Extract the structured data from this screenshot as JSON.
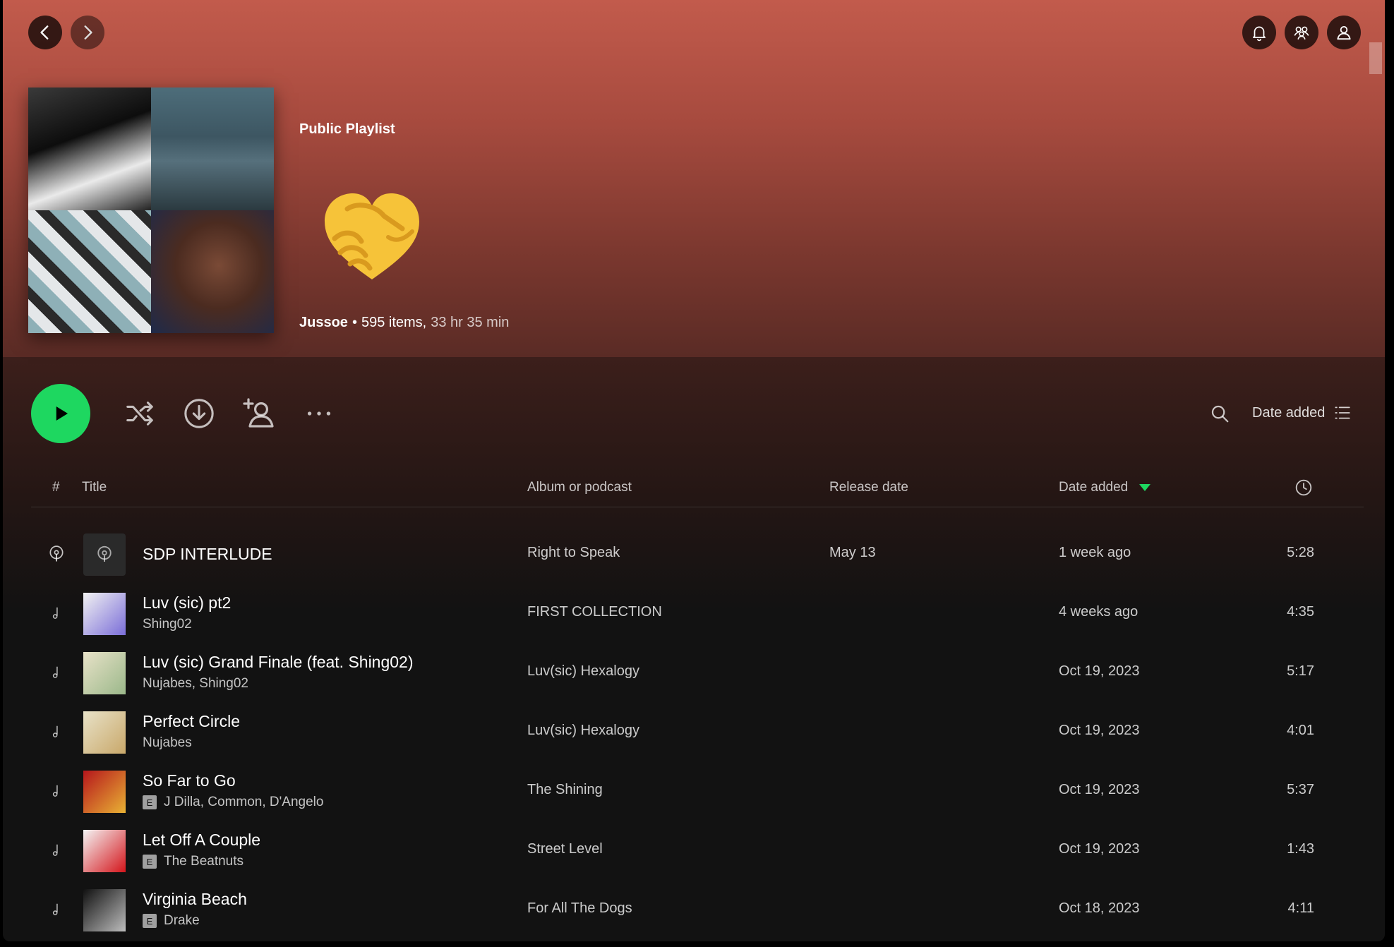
{
  "colors": {
    "accent": "#1ed760",
    "header_top": "#c25b4c",
    "background": "#121212"
  },
  "header": {
    "icons": [
      "chevron-left-icon",
      "chevron-right-icon",
      "bell-icon",
      "friends-icon",
      "user-icon"
    ]
  },
  "playlist": {
    "type_label": "Public Playlist",
    "emoji_title": "🫶",
    "owner": "Jussoe",
    "separator": "•",
    "item_count": "595 items,",
    "duration": "33 hr 35 min"
  },
  "actions": {
    "sort_label": "Date added"
  },
  "table": {
    "headers": {
      "num": "#",
      "title": "Title",
      "album": "Album or podcast",
      "release": "Release date",
      "added": "Date added"
    },
    "rows": [
      {
        "title": "SDP INTERLUDE",
        "artist": "",
        "explicit": false,
        "album": "Right to Speak",
        "release": "May 13",
        "added": "1 week ago",
        "duration": "5:28",
        "kind": "podcast",
        "thumb_colors": [
          "#2a2a2a",
          "#2a2a2a"
        ]
      },
      {
        "title": "Luv (sic) pt2",
        "artist": "Shing02",
        "explicit": false,
        "album": "FIRST COLLECTION",
        "release": "",
        "added": "4 weeks ago",
        "duration": "4:35",
        "kind": "track",
        "thumb_colors": [
          "#f2f2f2",
          "#7a6dd8"
        ]
      },
      {
        "title": "Luv (sic) Grand Finale (feat. Shing02)",
        "artist": "Nujabes, Shing02",
        "explicit": false,
        "album": "Luv(sic) Hexalogy",
        "release": "",
        "added": "Oct 19, 2023",
        "duration": "5:17",
        "kind": "track",
        "thumb_colors": [
          "#e8e2c8",
          "#9bb88a"
        ]
      },
      {
        "title": "Perfect Circle",
        "artist": "Nujabes",
        "explicit": false,
        "album": "Luv(sic) Hexalogy",
        "release": "",
        "added": "Oct 19, 2023",
        "duration": "4:01",
        "kind": "track",
        "thumb_colors": [
          "#e8e2c8",
          "#c9a86a"
        ]
      },
      {
        "title": "So Far to Go",
        "artist": "J Dilla, Common, D'Angelo",
        "explicit": true,
        "album": "The Shining",
        "release": "",
        "added": "Oct 19, 2023",
        "duration": "5:37",
        "kind": "track",
        "thumb_colors": [
          "#b5161c",
          "#e9b234"
        ]
      },
      {
        "title": "Let Off A Couple",
        "artist": "The Beatnuts",
        "explicit": true,
        "album": "Street Level",
        "release": "",
        "added": "Oct 19, 2023",
        "duration": "1:43",
        "kind": "track",
        "thumb_colors": [
          "#f4f4f4",
          "#d4151b"
        ]
      },
      {
        "title": "Virginia Beach",
        "artist": "Drake",
        "explicit": true,
        "album": "For All The Dogs",
        "release": "",
        "added": "Oct 18, 2023",
        "duration": "4:11",
        "kind": "track",
        "thumb_colors": [
          "#111111",
          "#bdbdbd"
        ]
      }
    ],
    "explicit_label": "E"
  }
}
